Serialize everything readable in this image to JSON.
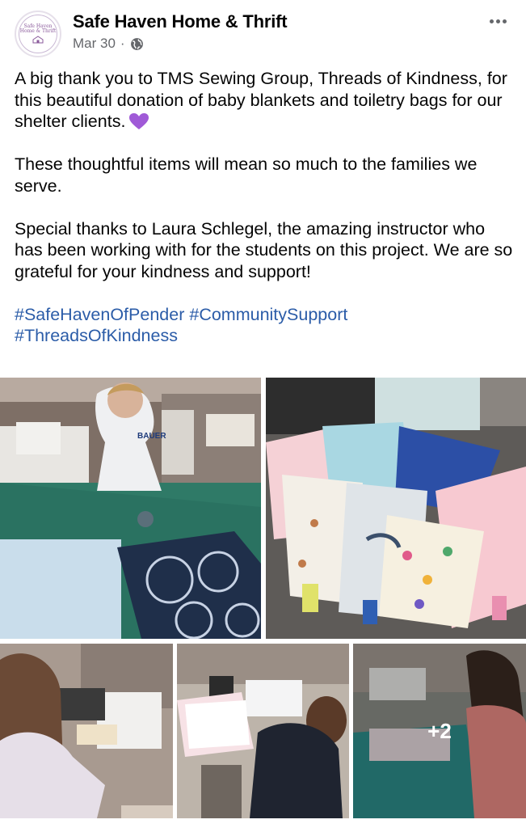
{
  "post": {
    "page_name": "Safe Haven Home & Thrift",
    "date": "Mar 30",
    "separator": "·",
    "avatar_text": [
      "Safe Haven",
      "Home & Thrift"
    ],
    "paragraphs": [
      "A big thank you to TMS Sewing Group, Threads of Kindness, for this beautiful donation of baby blankets and toiletry bags for our shelter clients.",
      "These thoughtful items will mean so much to the families we serve.",
      "Special thanks to Laura Schlegel, the amazing instructor who has been working with for the students on this project. We are so grateful for your kindness and support!"
    ],
    "hashtags": [
      "#SafeHavenOfPender",
      "#CommunitySupport",
      "#ThreadsOfKindness"
    ]
  },
  "icons": {
    "audience": "globe-icon",
    "menu": "more-options-icon",
    "emoji": "purple-heart-icon"
  },
  "photos": {
    "overflow_count": "+2",
    "shirt_text": "BAUER"
  },
  "colors": {
    "hashtag": "#2b5ca8",
    "secondary_text": "#65676b",
    "heart": "#a05ad7"
  }
}
